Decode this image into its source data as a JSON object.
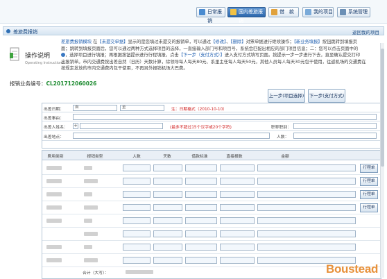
{
  "toolbar": {
    "items": [
      {
        "label": "日常报销",
        "color": "#4a8bd0"
      },
      {
        "label": "国内差旅报销",
        "color": "#f2c244"
      },
      {
        "label": "借　款",
        "color": "#e0a13c"
      },
      {
        "label": "我的项目",
        "color": "#7aaad9"
      },
      {
        "label": "系统管理",
        "color": "#6b8fb5"
      }
    ]
  },
  "section": {
    "title": "差旅费报销",
    "back_link": "返回我的项目"
  },
  "instructions": {
    "title": "操作说明",
    "subtitle": "Operating Instructions",
    "lines": [
      [
        "差旅费报销模块",
        "在",
        "【未提交单据】",
        "显示的是您填过未提交的报销单，可以通过",
        "【修改】",
        "、",
        "【删除】",
        "对票单据进行继续操作；",
        "【新业务填报】",
        "按钮跳转到填报页"
      ],
      [
        "面；跳转到填报页面后，您可以通过两种方式选择项目的选择，一直接输入部门号和项目号，系统会匹配出相应的部门项目信息；二：您可以点击页面中的"
      ],
      [
        "，选择项目进行填报；再根据按钮提示进行行程填报，点击",
        "【下一步（支付方式）】",
        "进入支付方式填写页面。按提示一步一步进行下去，直至确认提交打印"
      ],
      [
        "出报销单。市内交通费按出差自然（日历）天数计算，除领导每人每天80元、系里主任每人每天50元，其他人员每人每天30元包干使用，往返机场的交通费在"
      ],
      [
        "按规定发放的市内交通费内包干使用，不再另外报销机场大巴费。"
      ]
    ]
  },
  "document": {
    "label": "报销业务编号：",
    "number": "CL201712060026"
  },
  "nav": {
    "prev": "上一步(项目选择)",
    "next": "下一步(支付方式)"
  },
  "form": {
    "date_label": "出差日期：",
    "date_from": "自",
    "date_to": "至",
    "date_note": "注：日期格式（2010-10-10）",
    "reason_label": "出差事由：",
    "people_label": "出差人姓名：",
    "people_note": "(最多不超过15个汉字或20个字符)",
    "title_label": "职称职别：",
    "place_label": "出差地点：",
    "count_label": "人数："
  },
  "table": {
    "headers": [
      "费用类别",
      "报销类型",
      "人数",
      "天数",
      "借款标准",
      "直接报数",
      "金额"
    ],
    "trip_button": "行程单",
    "total_label": "合计（大写）："
  },
  "brand": {
    "logo_text": "Boustead"
  }
}
